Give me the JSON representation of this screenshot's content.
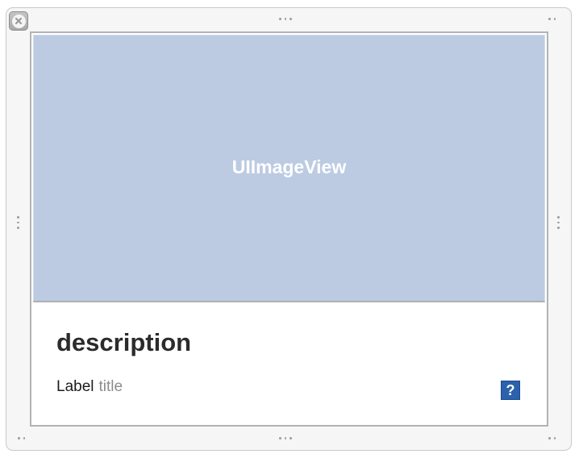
{
  "canvas": {
    "image_view_label": "UIImageView",
    "description_label": "description",
    "label_text": "Label",
    "title_text": "title",
    "help_glyph": "?"
  },
  "icons": {
    "close": "close-icon",
    "help": "help-icon"
  },
  "colors": {
    "image_view_fill": "#bccbe2",
    "help_button": "#2b62ad",
    "frame_background": "#f6f6f6"
  }
}
